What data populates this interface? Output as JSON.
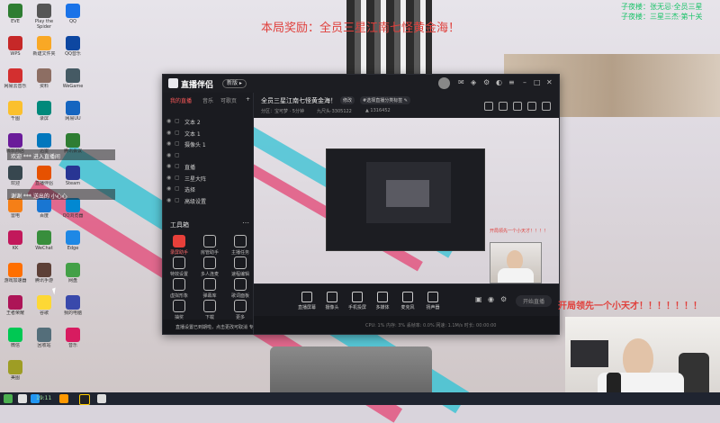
{
  "overlay": {
    "banner": "本局奖励：全员三星江南七怪黄金海！",
    "top_right_1": "子夜楼：张无忌·全员三星",
    "top_right_2": "子夜楼：三星三杰·第十关",
    "danmu": "开局领先一个小天才！！！！！！！",
    "floating_1": "欢迎 *** 进入直播间",
    "floating_2": "谢谢 *** 送出的 小心心"
  },
  "colors": {
    "accent": "#e8403a",
    "danmu": "#e0403c",
    "green_text": "#1cc36a"
  },
  "app": {
    "name": "直播伴侣",
    "version": "新版 ▸",
    "tabs": [
      "我的直播",
      "音乐",
      "可歌页"
    ],
    "sources": [
      {
        "name": "文本 2"
      },
      {
        "name": "文本 1"
      },
      {
        "name": "摄像头 1"
      },
      {
        "name": ""
      },
      {
        "name": "直播"
      },
      {
        "name": "三星大阵"
      },
      {
        "name": "选择"
      },
      {
        "name": "高级设置"
      }
    ],
    "tools_title": "工具箱",
    "tools": [
      {
        "label": "录屏助手"
      },
      {
        "label": "房管助手"
      },
      {
        "label": "主播任务"
      },
      {
        "label": "特效设置"
      },
      {
        "label": "多人连麦"
      },
      {
        "label": "速程编辑"
      },
      {
        "label": "虚拟形象"
      },
      {
        "label": "弹幕库"
      },
      {
        "label": "歌词面板"
      },
      {
        "label": "抽奖"
      },
      {
        "label": "下载"
      },
      {
        "label": "更多"
      }
    ],
    "notice": "直播设置已到期啦，点击更改可取消 专属报名",
    "stream_title": "全员三星江南七怪黄金海！",
    "chip_1": "修改",
    "chip_2": "#选择直播分类标签 ✎",
    "meta_1": "分区：宝可梦 · 5分钟",
    "meta_2": "九尺头·3305122",
    "meta_3": "▲ 1316452",
    "controls": [
      {
        "label": "直播屏幕"
      },
      {
        "label": "摄像头"
      },
      {
        "label": "手机投屏"
      },
      {
        "label": "多媒体"
      },
      {
        "label": "麦克风"
      },
      {
        "label": "扬声器"
      }
    ],
    "start_button": "开始直播",
    "status": "CPU: 1%   内存: 3%   丢帧率: 0.0%   网速: 1.1M/s   时长: 00:00:00"
  },
  "preview_danmu": "开局领先一个小天才！！！！",
  "desktop_icons": [
    {
      "label": "EVE"
    },
    {
      "label": "Play the Spider"
    },
    {
      "label": "QQ"
    },
    {
      "label": "WPS"
    },
    {
      "label": "新建文件夹"
    },
    {
      "label": "QQ音乐"
    },
    {
      "label": "网易云音乐"
    },
    {
      "label": "资料"
    },
    {
      "label": "WeGame"
    },
    {
      "label": "千图"
    },
    {
      "label": "录屏"
    },
    {
      "label": "网易UU"
    },
    {
      "label": "微软商店"
    },
    {
      "label": "迅雷"
    },
    {
      "label": "腾讯会议"
    },
    {
      "label": "欢迎"
    },
    {
      "label": "直播伴侣"
    },
    {
      "label": "Steam"
    },
    {
      "label": "雷电"
    },
    {
      "label": "百度"
    },
    {
      "label": "QQ浏览器"
    },
    {
      "label": "KK"
    },
    {
      "label": "WeChat"
    },
    {
      "label": "Edge"
    },
    {
      "label": "游戏加速器"
    },
    {
      "label": "腾讯手游"
    },
    {
      "label": "网盘"
    },
    {
      "label": "王者荣耀"
    },
    {
      "label": "谷歌"
    },
    {
      "label": "我的电脑"
    },
    {
      "label": "微信"
    },
    {
      "label": "回收站"
    },
    {
      "label": "音乐"
    },
    {
      "label": "美图"
    }
  ],
  "taskbar": {
    "clock": "19:11",
    "date": ""
  }
}
